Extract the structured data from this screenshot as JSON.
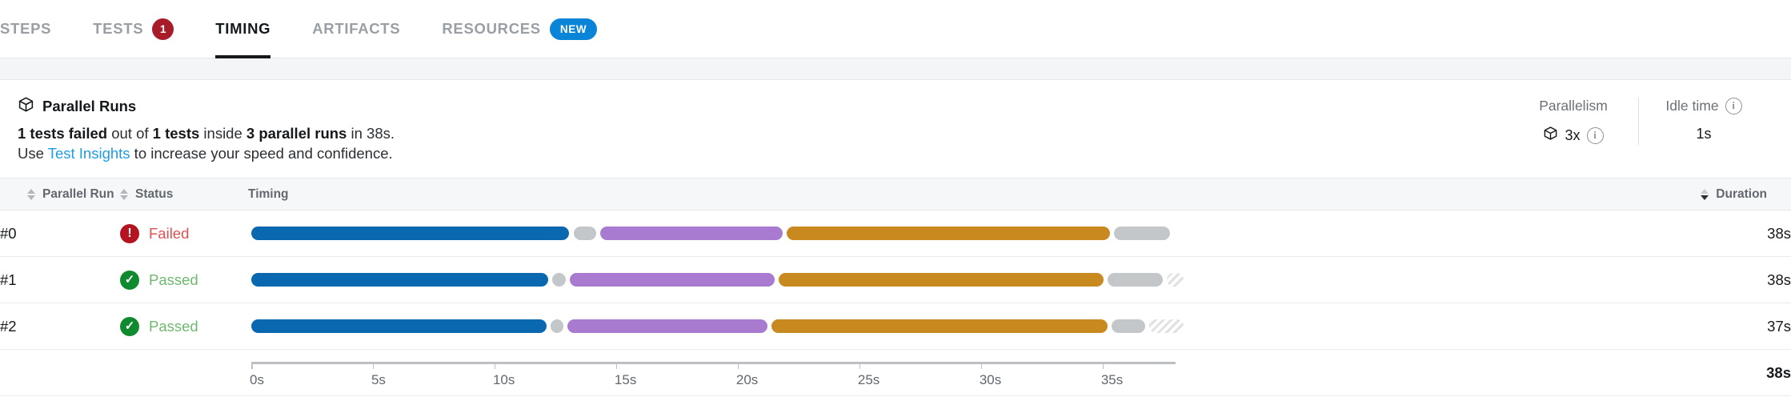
{
  "tabs": [
    {
      "label": "STEPS",
      "active": false,
      "badge": null,
      "badge_type": null
    },
    {
      "label": "TESTS",
      "active": false,
      "badge": "1",
      "badge_type": "count"
    },
    {
      "label": "TIMING",
      "active": true,
      "badge": null,
      "badge_type": null
    },
    {
      "label": "ARTIFACTS",
      "active": false,
      "badge": null,
      "badge_type": null
    },
    {
      "label": "RESOURCES",
      "active": false,
      "badge": "NEW",
      "badge_type": "new"
    }
  ],
  "summary": {
    "icon": "cube-icon",
    "title": "Parallel Runs",
    "line1": {
      "part1": "1 tests failed",
      "part2": " out of ",
      "part3": "1 tests",
      "part4": " inside ",
      "part5": "3 parallel runs",
      "part6": " in 38s."
    },
    "line2": {
      "prefix": "Use ",
      "link": "Test Insights",
      "suffix": " to increase your speed and confidence."
    }
  },
  "metrics": [
    {
      "label": "Parallelism",
      "label_info": false,
      "value": "3x",
      "value_icon": "cube-icon",
      "value_info": true
    },
    {
      "label": "Idle time",
      "label_info": true,
      "value": "1s",
      "value_icon": null,
      "value_info": false
    }
  ],
  "table": {
    "columns": [
      {
        "key": "run",
        "label": "Parallel Run",
        "sortable": true,
        "sort_state": "none"
      },
      {
        "key": "status",
        "label": "Status",
        "sortable": true,
        "sort_state": "none"
      },
      {
        "key": "timing",
        "label": "Timing",
        "sortable": false,
        "sort_state": null
      },
      {
        "key": "duration",
        "label": "Duration",
        "sortable": true,
        "sort_state": "desc"
      }
    ],
    "rows": [
      {
        "run": "#0",
        "status": "Failed",
        "status_kind": "failed",
        "duration": "38s",
        "segments": [
          {
            "kind": "run",
            "color": "#0a68b0",
            "start_s": 0.0,
            "end_s": 13.05
          },
          {
            "kind": "gap",
            "color": "#c4c7ca",
            "start_s": 13.2,
            "end_s": 14.1
          },
          {
            "kind": "run",
            "color": "#a97bd0",
            "start_s": 14.2,
            "end_s": 21.7
          },
          {
            "kind": "run",
            "color": "#c8891e",
            "start_s": 21.8,
            "end_s": 35.1
          },
          {
            "kind": "gap",
            "color": "#c4c7ca",
            "start_s": 35.2,
            "end_s": 37.5
          }
        ]
      },
      {
        "run": "#1",
        "status": "Passed",
        "status_kind": "passed",
        "duration": "38s",
        "segments": [
          {
            "kind": "run",
            "color": "#0a68b0",
            "start_s": 0.0,
            "end_s": 12.2
          },
          {
            "kind": "gap",
            "color": "#c4c7ca",
            "start_s": 12.3,
            "end_s": 12.85
          },
          {
            "kind": "run",
            "color": "#a97bd0",
            "start_s": 12.95,
            "end_s": 21.4
          },
          {
            "kind": "run",
            "color": "#c8891e",
            "start_s": 21.5,
            "end_s": 34.85
          },
          {
            "kind": "gap",
            "color": "#c4c7ca",
            "start_s": 34.95,
            "end_s": 37.2
          },
          {
            "kind": "idle",
            "color": "hatch",
            "start_s": 37.3,
            "end_s": 38.0
          }
        ]
      },
      {
        "run": "#2",
        "status": "Passed",
        "status_kind": "passed",
        "duration": "37s",
        "segments": [
          {
            "kind": "run",
            "color": "#0a68b0",
            "start_s": 0.0,
            "end_s": 12.15
          },
          {
            "kind": "gap",
            "color": "#c4c7ca",
            "start_s": 12.25,
            "end_s": 12.75
          },
          {
            "kind": "run",
            "color": "#a97bd0",
            "start_s": 12.85,
            "end_s": 21.1
          },
          {
            "kind": "run",
            "color": "#c8891e",
            "start_s": 21.2,
            "end_s": 35.0
          },
          {
            "kind": "gap",
            "color": "#c4c7ca",
            "start_s": 35.1,
            "end_s": 36.5
          },
          {
            "kind": "idle",
            "color": "hatch",
            "start_s": 36.6,
            "end_s": 38.0
          }
        ]
      }
    ],
    "total_duration": "38s"
  },
  "chart_data": {
    "type": "bar",
    "title": "Parallel Runs timeline",
    "xlabel": "",
    "ylabel": "",
    "xlim": [
      0,
      38
    ],
    "grid": false,
    "axis_ticks": [
      "0s",
      "5s",
      "10s",
      "15s",
      "20s",
      "25s",
      "30s",
      "35s"
    ],
    "axis_tick_values": [
      0,
      5,
      10,
      15,
      20,
      25,
      30,
      35
    ],
    "categories": [
      "#0",
      "#1",
      "#2"
    ],
    "values": [
      38,
      38,
      37
    ],
    "legend": [],
    "series": [
      {
        "name": "#0",
        "values": [
          38
        ]
      },
      {
        "name": "#1",
        "values": [
          38
        ]
      },
      {
        "name": "#2",
        "values": [
          37
        ]
      }
    ]
  },
  "colors": {
    "accent_blue": "#0a68b0",
    "purple": "#a97bd0",
    "orange": "#c8891e",
    "grey_gap": "#c4c7ca",
    "fail_red": "#b3141f",
    "pass_green": "#108a2e",
    "link_blue": "#1f9ce4",
    "badge_new_blue": "#0a84d6",
    "badge_count_red": "#a81b28"
  }
}
